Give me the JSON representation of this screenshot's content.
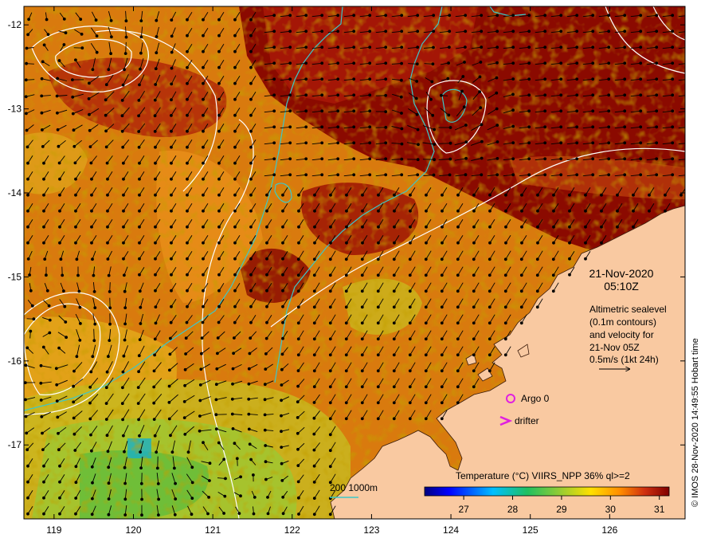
{
  "map": {
    "lon_ticks": [
      "119",
      "120",
      "121",
      "122",
      "123",
      "124",
      "125",
      "126"
    ],
    "lat_ticks": [
      "-12",
      "-13",
      "-14",
      "-15",
      "-16",
      "-17"
    ],
    "lon_range": [
      118.62,
      126.95
    ],
    "lat_range": [
      -17.88,
      -11.78
    ]
  },
  "annotation": {
    "date": "21-Nov-2020",
    "time": "05:10Z",
    "legend_lines": [
      "Altimetric sealevel",
      "(0.1m contours)",
      "and velocity for",
      "21-Nov 05Z",
      "0.5m/s (1kt 24h)"
    ]
  },
  "markers": {
    "argo_label": "Argo 0",
    "drifter_label": "drifter",
    "marker_color": "#e020e0"
  },
  "bathymetry": {
    "label": "200  1000m",
    "color": "#3cc8c8"
  },
  "colorbar": {
    "title": "Temperature (°C) VIIRS_NPP 36% ql>=2",
    "ticks": [
      "27",
      "28",
      "29",
      "30",
      "31"
    ],
    "range": [
      26.2,
      31.2
    ]
  },
  "credit": "© IMOS 28-Nov-2020 14:49:55 Hobart time",
  "colors": {
    "land": "#f9c9a1",
    "sea_hot": "#8b0000",
    "vector": "#000000",
    "contour": "#ffffff"
  }
}
